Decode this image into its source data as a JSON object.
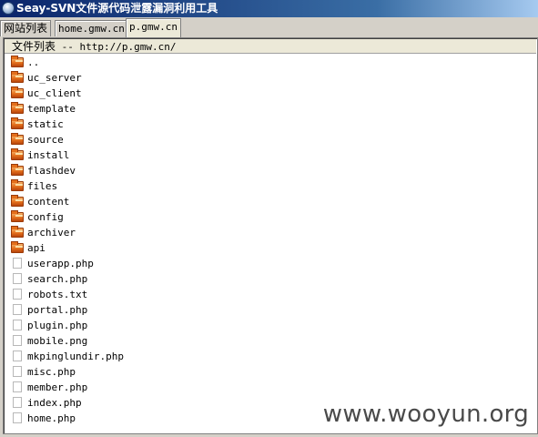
{
  "window": {
    "title": "Seay-SVN文件源代码泄露漏洞利用工具",
    "icon": "app-globe-icon"
  },
  "tabs": [
    {
      "label": "网站列表",
      "active": false
    },
    {
      "label": "home.gmw.cn",
      "active": false
    },
    {
      "label": "p.gmw.cn",
      "active": true
    }
  ],
  "file_list": {
    "header_prefix": "文件列表",
    "header_suffix": " -- http://p.gmw.cn/",
    "items": [
      {
        "name": "..",
        "type": "folder"
      },
      {
        "name": "uc_server",
        "type": "folder"
      },
      {
        "name": "uc_client",
        "type": "folder"
      },
      {
        "name": "template",
        "type": "folder"
      },
      {
        "name": "static",
        "type": "folder"
      },
      {
        "name": "source",
        "type": "folder"
      },
      {
        "name": "install",
        "type": "folder"
      },
      {
        "name": "flashdev",
        "type": "folder"
      },
      {
        "name": "files",
        "type": "folder"
      },
      {
        "name": "content",
        "type": "folder"
      },
      {
        "name": "config",
        "type": "folder"
      },
      {
        "name": "archiver",
        "type": "folder"
      },
      {
        "name": "api",
        "type": "folder"
      },
      {
        "name": "userapp.php",
        "type": "file"
      },
      {
        "name": "search.php",
        "type": "file"
      },
      {
        "name": "robots.txt",
        "type": "file"
      },
      {
        "name": "portal.php",
        "type": "file"
      },
      {
        "name": "plugin.php",
        "type": "file"
      },
      {
        "name": "mobile.png",
        "type": "file"
      },
      {
        "name": "mkpinglundir.php",
        "type": "file"
      },
      {
        "name": "misc.php",
        "type": "file"
      },
      {
        "name": "member.php",
        "type": "file"
      },
      {
        "name": "index.php",
        "type": "file"
      },
      {
        "name": "home.php",
        "type": "file"
      }
    ]
  },
  "watermark": "www.wooyun.org"
}
